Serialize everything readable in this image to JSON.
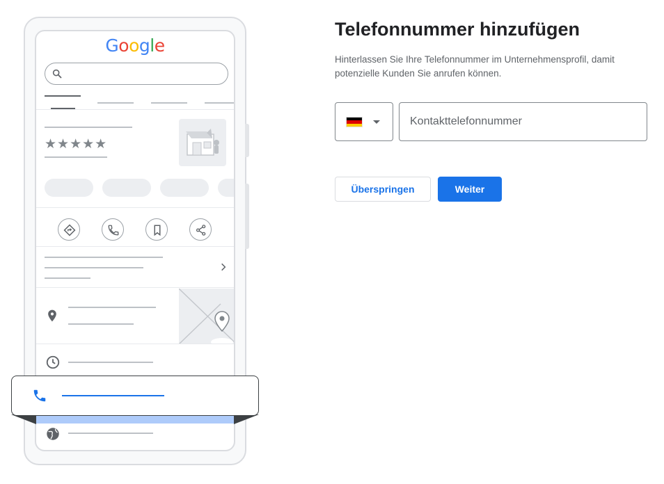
{
  "illustration": {
    "logo_letters": [
      {
        "ch": "G",
        "color": "#4285F4"
      },
      {
        "ch": "o",
        "color": "#EA4335"
      },
      {
        "ch": "o",
        "color": "#FBBC05"
      },
      {
        "ch": "g",
        "color": "#4285F4"
      },
      {
        "ch": "l",
        "color": "#34A853"
      },
      {
        "ch": "e",
        "color": "#EA4335"
      }
    ],
    "stars": "★★★★★",
    "highlight_color": "#1A73E8",
    "icons": [
      "search-icon",
      "directions-icon",
      "call-icon",
      "bookmark-icon",
      "share-icon",
      "chevron-right-icon",
      "location-pin-icon",
      "clock-icon",
      "phone-icon",
      "globe-icon"
    ]
  },
  "form": {
    "title": "Telefonnummer hinzufügen",
    "description": "Hinterlassen Sie Ihre Telefonnummer im Unternehmensprofil, damit potenzielle Kunden Sie anrufen können.",
    "country": {
      "selected": "Deutschland",
      "flag_colors": [
        "#000000",
        "#DD0000",
        "#FFCE00"
      ]
    },
    "phone_input": {
      "placeholder": "Kontakttelefonnummer",
      "value": ""
    },
    "skip_label": "Überspringen",
    "next_label": "Weiter",
    "accent_color": "#1A73E8"
  }
}
